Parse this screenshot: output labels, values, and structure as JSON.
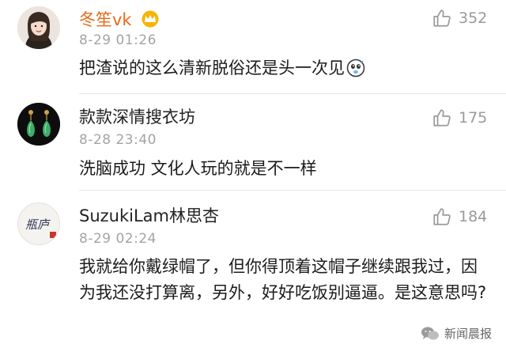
{
  "comments": [
    {
      "username": "冬笙vk",
      "time": "8-29 01:26",
      "likes": "352",
      "text": "把渣说的这么清新脱俗还是头一次见",
      "name_color": "#e86a17",
      "avatar_icon": "woman-portrait-avatar",
      "badge_icon": "crown-badge-icon",
      "emoji_icon": "face-emoji-icon"
    },
    {
      "username": "款款深情搜衣坊",
      "time": "8-28 23:40",
      "likes": "175",
      "text": "洗脑成功 文化人玩的就是不一样",
      "name_color": "#222222",
      "avatar_icon": "jade-earrings-avatar"
    },
    {
      "username": "SuzukiLam林思杏",
      "time": "8-29 02:24",
      "likes": "184",
      "text": "我就给你戴绿帽了，但你得顶着这帽子继续跟我过，因为我还没打算离，另外，好好吃饭别逼逼。是这意思吗?",
      "name_color": "#222222",
      "avatar_icon": "calligraphy-avatar",
      "avatar_text": "瓶庐"
    }
  ],
  "like_icon": "thumbs-up-icon",
  "watermark": {
    "text": "新闻晨报",
    "icon": "wechat-logo-icon"
  }
}
